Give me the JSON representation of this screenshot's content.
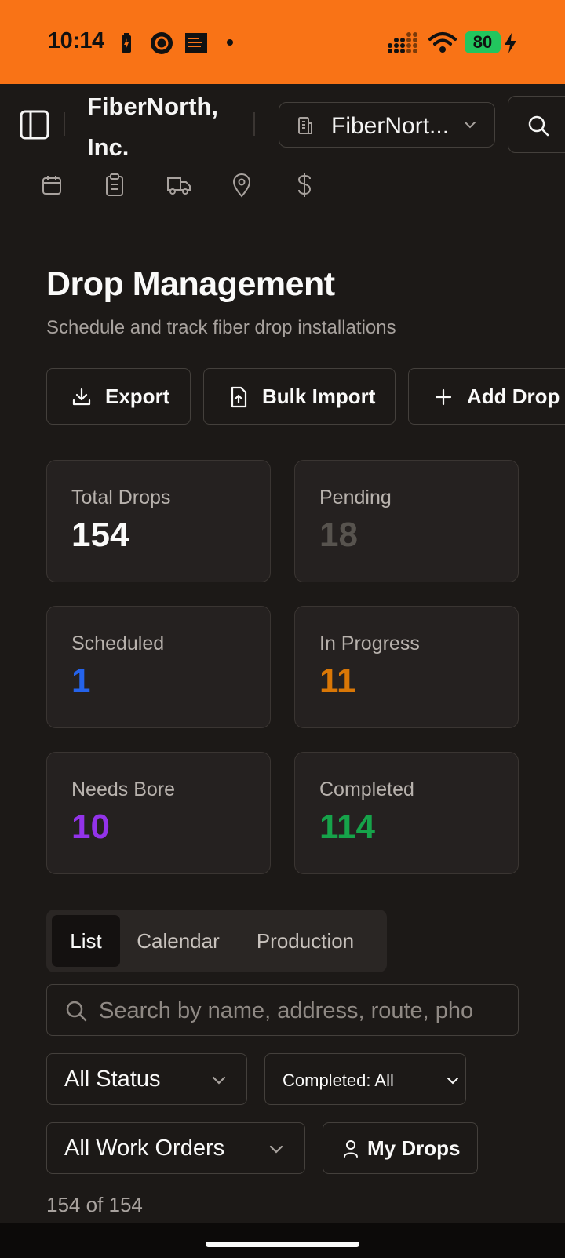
{
  "status_bar": {
    "time": "10:14",
    "battery": "80",
    "background": "#f97316"
  },
  "header": {
    "org_name": "FiberNorth, Inc.",
    "org_select": "FiberNort...",
    "nav_icons": [
      "calendar-icon",
      "clipboard-icon",
      "truck-icon",
      "map-pin-icon",
      "dollar-icon"
    ]
  },
  "page": {
    "title": "Drop Management",
    "subtitle": "Schedule and track fiber drop installations"
  },
  "actions": {
    "export": "Export",
    "bulk_import": "Bulk Import",
    "add_drop": "Add Drop"
  },
  "stats": [
    {
      "label": "Total Drops",
      "value": "154",
      "color": "#fafaf9"
    },
    {
      "label": "Pending",
      "value": "18",
      "color": "#57534e"
    },
    {
      "label": "Scheduled",
      "value": "1",
      "color": "#2563eb"
    },
    {
      "label": "In Progress",
      "value": "11",
      "color": "#d97706"
    },
    {
      "label": "Needs Bore",
      "value": "10",
      "color": "#9333ea"
    },
    {
      "label": "Completed",
      "value": "114",
      "color": "#16a34a"
    }
  ],
  "tabs": [
    {
      "label": "List",
      "active": true
    },
    {
      "label": "Calendar",
      "active": false
    },
    {
      "label": "Production",
      "active": false
    }
  ],
  "search": {
    "placeholder": "Search by name, address, route, pho"
  },
  "filters": {
    "status": "All Status",
    "completed": "Completed: All",
    "work_orders": "All Work Orders",
    "my_drops": "My Drops"
  },
  "result_count": "154 of 154"
}
